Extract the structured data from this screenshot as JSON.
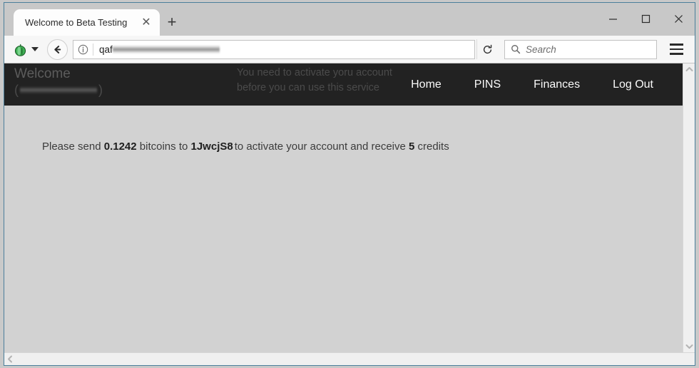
{
  "browser": {
    "tab": {
      "title": "Welcome to Beta Testing",
      "close_label": "✕",
      "newtab_label": "+"
    },
    "window_controls": {
      "minimize": "minimize-button",
      "maximize": "maximize-button",
      "close": "close-button"
    },
    "toolbar": {
      "onion_button": "tor-onion-menu",
      "back_button": "back",
      "identity_icon": "site-information",
      "url_value": "qaf",
      "url_redacted": true,
      "reload_button": "reload",
      "search_placeholder": "Search",
      "search_value": "",
      "menu_button": "open-menu"
    }
  },
  "site": {
    "header": {
      "welcome_title": "Welcome",
      "user_open_paren": "(",
      "user_close_paren": ")",
      "user_redacted": true,
      "notice": "You need to activate yoru account before you can use this service"
    },
    "nav": [
      {
        "label": "Home"
      },
      {
        "label": "PINS"
      },
      {
        "label": "Finances"
      },
      {
        "label": "Log Out"
      }
    ],
    "body": {
      "message_prefix": "Please send ",
      "amount": "0.1242",
      "message_mid": " bitcoins to ",
      "address_visible": "1JwcjS8",
      "address_redacted": true,
      "message_suffix": "to activate your account and receive ",
      "credits": "5",
      "message_end": " credits"
    }
  },
  "colors": {
    "header_bg": "#222222",
    "page_bg": "#d2d2d2",
    "window_border": "#4b7f9b",
    "chrome_bg": "#c8c8c8",
    "onion_green": "#3faf54"
  }
}
